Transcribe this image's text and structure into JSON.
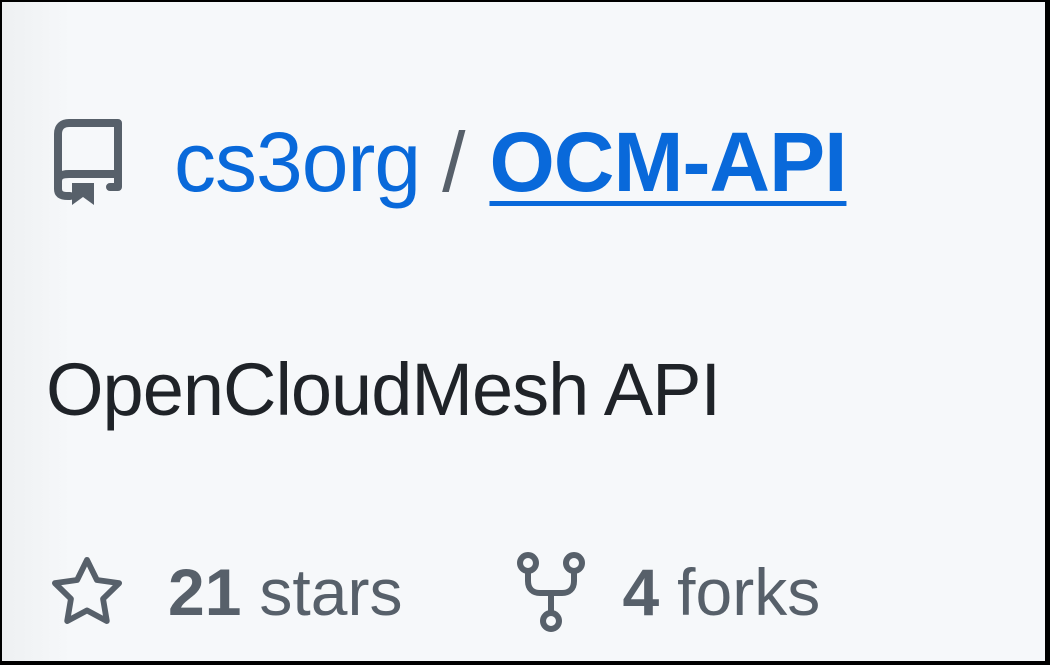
{
  "repo": {
    "owner": "cs3org",
    "separator": "/",
    "name": "OCM-API",
    "icon": "repo-icon",
    "description": "OpenCloudMesh API"
  },
  "stats": {
    "stars": {
      "count": "21",
      "label": "stars",
      "icon": "star-icon"
    },
    "forks": {
      "count": "4",
      "label": "forks",
      "icon": "repo-forked-icon"
    }
  },
  "colors": {
    "link": "#0969da",
    "muted": "#57606a",
    "text": "#1f2328",
    "background": "#f6f8fa",
    "border": "#000000"
  }
}
